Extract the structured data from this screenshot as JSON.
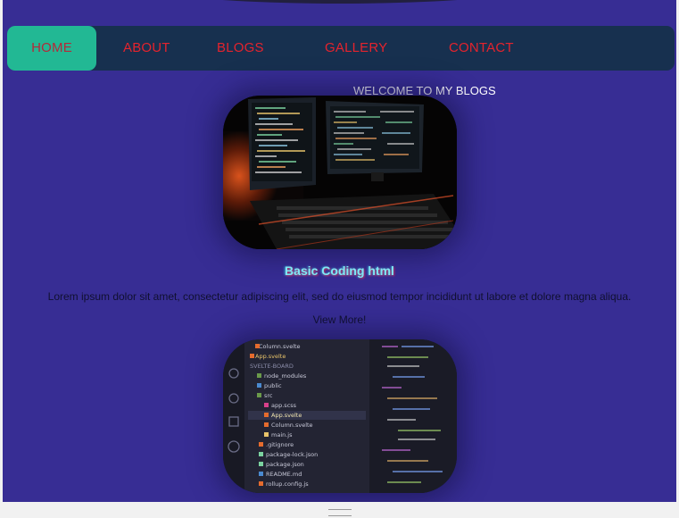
{
  "nav": {
    "items": [
      {
        "label": "HOME",
        "active": true
      },
      {
        "label": "ABOUT",
        "active": false
      },
      {
        "label": "BLOGS",
        "active": false
      },
      {
        "label": "GALLERY",
        "active": false
      },
      {
        "label": "CONTACT",
        "active": false
      }
    ]
  },
  "main": {
    "welcome": "WELCOME TO MY BLOGS",
    "post": {
      "title": "Basic Coding html",
      "text": "Lorem ipsum dolor sit amet, consectetur adipiscing elit, sed do eiusmod tempor incididunt ut labore et dolore magna aliqua.",
      "view_more": "View More!"
    },
    "editor_files": [
      "Column.svelte",
      "App.svelte",
      "SVELTE-BOARD",
      "node_modules",
      "public",
      "src",
      "app.scss",
      "App.svelte",
      "Column.svelte",
      "main.js",
      ".gitignore",
      "package-lock.json",
      "package.json",
      "README.md",
      "rollup.config.js"
    ]
  },
  "colors": {
    "page_bg": "#372d94",
    "nav_bg": "#17304f",
    "nav_active": "#22b894",
    "nav_text": "#e5232d"
  }
}
